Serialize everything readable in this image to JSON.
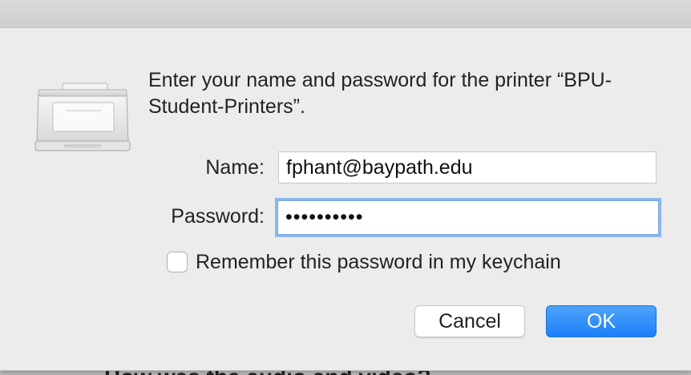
{
  "dialog": {
    "message": "Enter your name and password for the printer “BPU-Student-Printers”.",
    "name_label": "Name:",
    "name_value": "fphant@baypath.edu",
    "password_label": "Password:",
    "password_value": "••••••••••",
    "remember_label": "Remember this password in my keychain",
    "remember_checked": false,
    "cancel_label": "Cancel",
    "ok_label": "OK",
    "icon": "printer-icon",
    "accent_color": "#1b7ff7"
  },
  "background": {
    "partial_text": "How was the audio and video?"
  }
}
